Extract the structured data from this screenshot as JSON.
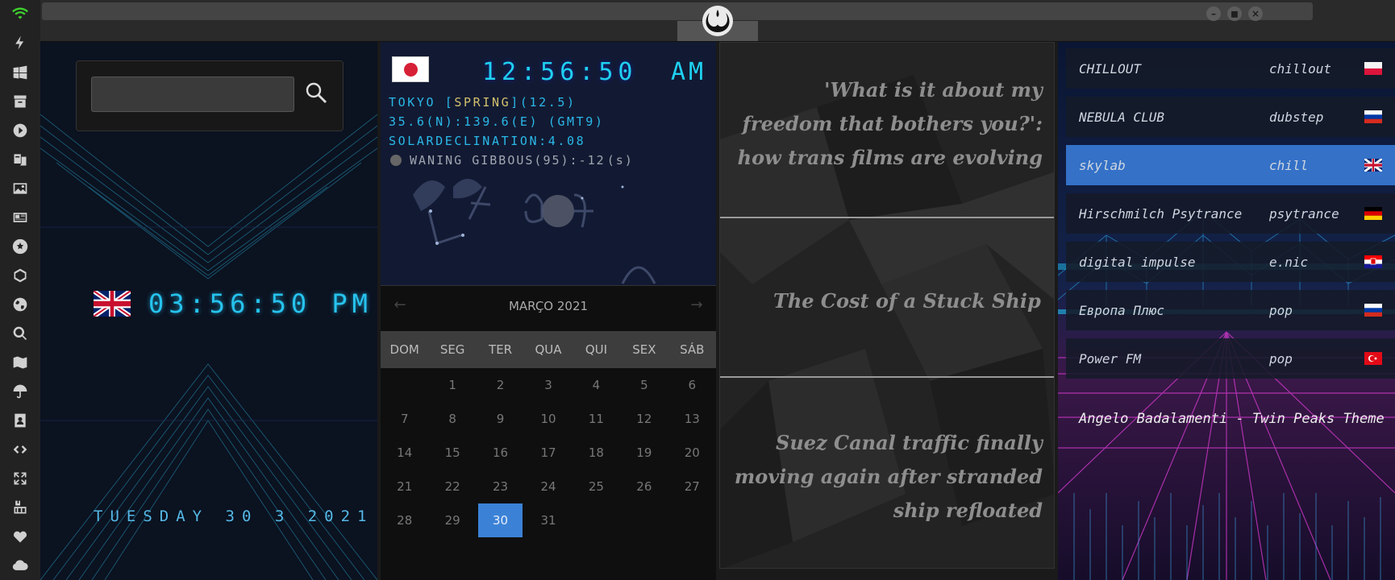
{
  "window": {
    "logo_name": "rebel-alliance-logo",
    "buttons": [
      "–",
      "◼",
      "×"
    ]
  },
  "sidebar": {
    "icons": [
      "wifi-icon",
      "bolt-icon",
      "windows-icon",
      "archive-icon",
      "play-icon",
      "translate-icon",
      "image-icon",
      "news-icon",
      "settings-icon",
      "hexagon-icon",
      "globe-icon",
      "search-icon",
      "map-icon",
      "umbrella-icon",
      "contacts-icon",
      "code-icon",
      "fullscreen-icon",
      "youtube-icon",
      "heart-icon",
      "cloud-icon"
    ]
  },
  "local": {
    "search_value": "",
    "flag": "UK",
    "time": "03:56:50 PM",
    "date": "TUESDAY 30 3 2021"
  },
  "world": {
    "flag": "JP",
    "time": "12:56:50",
    "ampm": "AM",
    "city_prefix": "TOKYO [",
    "season": "SPRING",
    "city_suffix": "](12.5)",
    "coords": "35.6(N):139.6(E) (GMT9)",
    "solar": "SOLARDECLINATION:4.08",
    "moon": "WANING GIBBOUS(95):-12",
    "moon_suffix": "(s)"
  },
  "calendar": {
    "title": "MARÇO 2021",
    "prev": "←",
    "next": "→",
    "weekdays": [
      "DOM",
      "SEG",
      "TER",
      "QUA",
      "QUI",
      "SEX",
      "SÁB"
    ],
    "days": [
      "",
      "1",
      "2",
      "3",
      "4",
      "5",
      "6",
      "7",
      "8",
      "9",
      "10",
      "11",
      "12",
      "13",
      "14",
      "15",
      "16",
      "17",
      "18",
      "19",
      "20",
      "21",
      "22",
      "23",
      "24",
      "25",
      "26",
      "27",
      "28",
      "29",
      "30",
      "31"
    ],
    "selected": "30"
  },
  "news": {
    "items": [
      "'What is it about my freedom that bothers you?': how trans films are evolving",
      "The Cost of a Stuck Ship",
      "Suez Canal traffic finally moving again after stranded ship refloated"
    ]
  },
  "radio": {
    "stations": [
      {
        "name": "CHILLOUT",
        "genre": "chillout",
        "flag": "PL"
      },
      {
        "name": "NEBULA CLUB",
        "genre": "dubstep",
        "flag": "RU"
      },
      {
        "name": "skylab",
        "genre": "chill",
        "flag": "UK"
      },
      {
        "name": "Hirschmilch Psytrance",
        "genre": "psytrance",
        "flag": "DE"
      },
      {
        "name": "digital impulse",
        "genre": "e.nic",
        "flag": "HR"
      },
      {
        "name": "Европа Плюс",
        "genre": "pop",
        "flag": "RU"
      },
      {
        "name": "Power FM",
        "genre": "pop",
        "flag": "TR"
      }
    ],
    "active_index": 2,
    "now_playing": "Angelo Badalamenti - Twin Peaks Theme"
  },
  "colors": {
    "accent_cyan": "#27c3ee",
    "calendar_selected": "#3b82d6",
    "radio_active": "#3778d2"
  }
}
